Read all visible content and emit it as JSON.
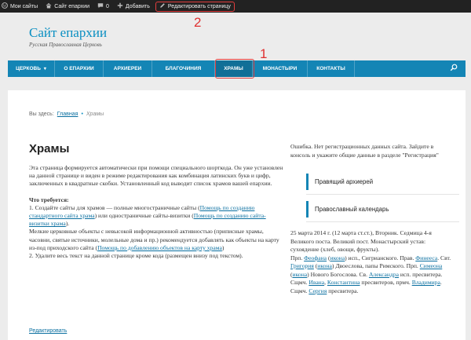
{
  "adminbar": {
    "my_sites": "Мои сайты",
    "site_name": "Сайт епархии",
    "comments_count": "0",
    "add_new": "Добавить",
    "edit_page": "Редактировать страницу",
    "icons": [
      "wordpress-icon",
      "home-icon",
      "comment-icon",
      "plus-icon",
      "pencil-icon"
    ]
  },
  "annotations": {
    "nav_marker": "1",
    "edit_marker": "2",
    "highlight_color": "#e23d3d"
  },
  "header": {
    "title": "Сайт епархии",
    "description": "Русская Православная Церковь"
  },
  "nav": {
    "items": [
      {
        "label": "ЦЕРКОВЬ",
        "has_dropdown": true
      },
      {
        "label": "О ЕПАРХИИ"
      },
      {
        "label": "АРХИЕРЕИ"
      },
      {
        "label": "БЛАГОЧИНИЯ"
      },
      {
        "label": "ХРАМЫ",
        "active": true
      },
      {
        "label": "МОНАСТЫРИ"
      },
      {
        "label": "КОНТАКТЫ"
      }
    ],
    "dropdown_glyph": "▾",
    "search_icon": "search-icon",
    "bar_color": "#1485b5"
  },
  "breadcrumb": {
    "prefix": "Вы здесь:",
    "home": "Главная",
    "separator": "•",
    "current": "Храмы"
  },
  "main": {
    "title": "Храмы",
    "intro": "Эта страница формируется автоматически при помощи специального шорткода. Он уже установлен на данной странице и виден в режиме редактирования как комбинация латинских букв и цифр, заключенных в квадратные скобки. Установленный код выводит  список храмов вашей епархии.",
    "required_heading": "Что требуется:",
    "step1_a": "1. Создайте сайты для храмов — полные многостраничные сайты (",
    "step1_link1": "Помощь по созданию стандартного сайта храма",
    "step1_b": ") или одностраничные сайты-визитки (",
    "step1_link2": "Помощь по созданию сайта-визитки храма",
    "step1_c": ").",
    "step1_d": "Мелкие церковные объекты с невысокой информационной активностью (приписные храмы, часовни, святые источники, молельные дома и пр.) рекомендуется добавлять как объекты на карту из-под приходского сайта (",
    "step1_link3": "Помощь по добавлению объектов на карту храма",
    "step1_e": ")",
    "step2": "2. Удалите весь текст на данной странице кроме кода (размещен внизу под текстом).",
    "edit_link": "Редактировать"
  },
  "sidebar": {
    "error_text": "Ошибка. Нет регистрационных данных сайта. Зайдите в консоль и укажите общие данные в разделе \"Регистрация\"",
    "widget1": "Правящий архиерей",
    "widget2": "Православный календарь",
    "cal_a": "25 марта 2014 г. (12 марта ст.ст.), Вторник. Седмица 4-я Великого поста. Великий пост. Монастырский устав: сухоядение (хлеб, овощи, фрукты).",
    "cal_b": "Прп. ",
    "cal_l1": "Феофана",
    "cal_c": " (",
    "cal_l2": "икона",
    "cal_d": ") исп., Сигрианского. Прав. ",
    "cal_l3": "Финееса",
    "cal_e": ". Свт. ",
    "cal_l4": "Григория",
    "cal_f": " (",
    "cal_l5": "икона",
    "cal_g": ") Двоеслова, папы Римского. Прп. ",
    "cal_l6": "Симеона",
    "cal_h": " (",
    "cal_l7": "икона",
    "cal_i": ") Нового Богослова. Св. ",
    "cal_l8": "Александра",
    "cal_j": " исп. пресвитера. Сщмч. ",
    "cal_l9": "Ивана",
    "cal_k": ", ",
    "cal_l10": "Константина",
    "cal_l": " пресвитеров, прмч. ",
    "cal_l11": "Владимира",
    "cal_m": ". Сщмч. ",
    "cal_l12": "Сергия",
    "cal_n": " пресвитера."
  }
}
